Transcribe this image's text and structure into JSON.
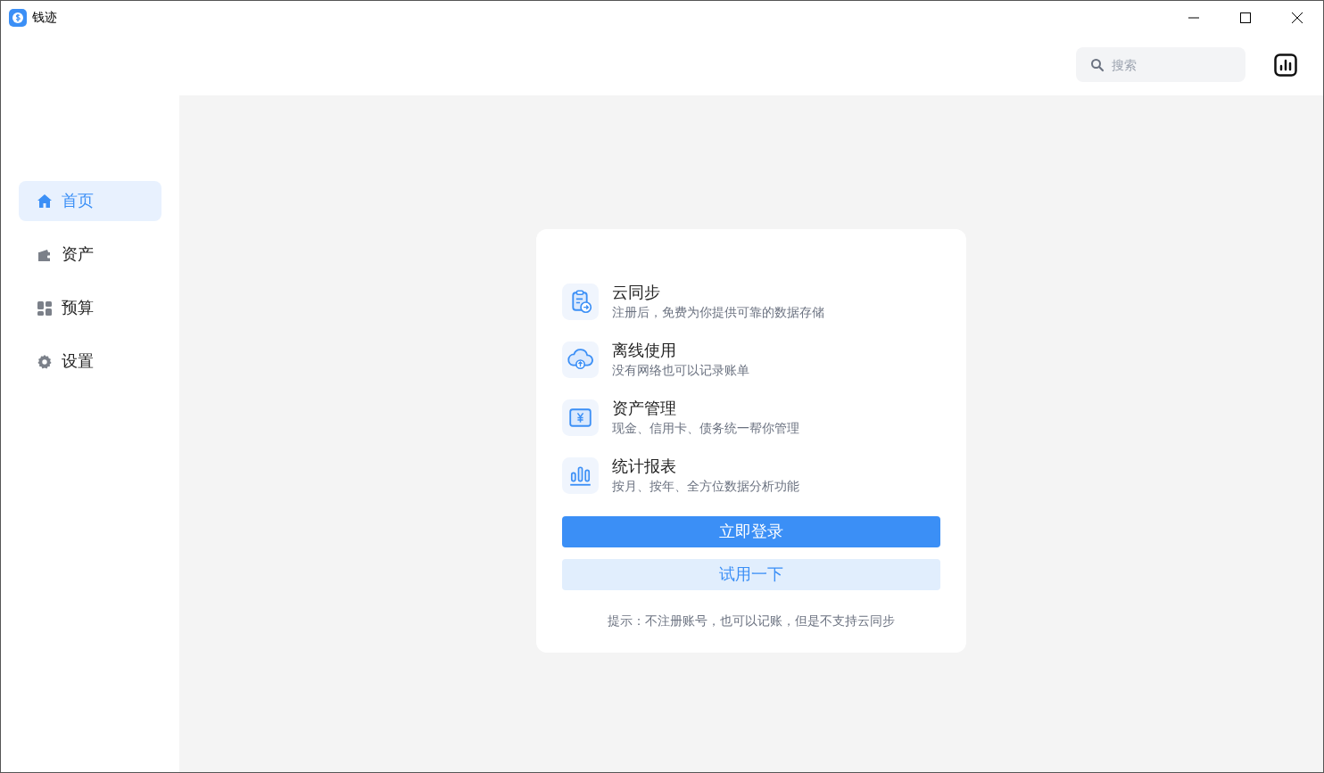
{
  "window": {
    "title": "钱迹"
  },
  "search": {
    "placeholder": "搜索"
  },
  "sidebar": {
    "items": [
      {
        "label": "首页",
        "kind": "home",
        "selected": true
      },
      {
        "label": "资产",
        "kind": "wallet",
        "selected": false
      },
      {
        "label": "预算",
        "kind": "grid",
        "selected": false
      },
      {
        "label": "设置",
        "kind": "gear",
        "selected": false
      }
    ]
  },
  "features": [
    {
      "kind": "sync",
      "title": "云同步",
      "subtitle": "注册后，免费为你提供可靠的数据存储"
    },
    {
      "kind": "offline",
      "title": "离线使用",
      "subtitle": "没有网络也可以记录账单"
    },
    {
      "kind": "assets",
      "title": "资产管理",
      "subtitle": "现金、信用卡、债务统一帮你管理"
    },
    {
      "kind": "stats",
      "title": "统计报表",
      "subtitle": "按月、按年、全方位数据分析功能"
    }
  ],
  "buttons": [
    {
      "kind": "primary",
      "label": "立即登录"
    },
    {
      "kind": "secondary",
      "label": "试用一下"
    }
  ],
  "hint": "提示：不注册账号，也可以记账，但是不支持云同步"
}
